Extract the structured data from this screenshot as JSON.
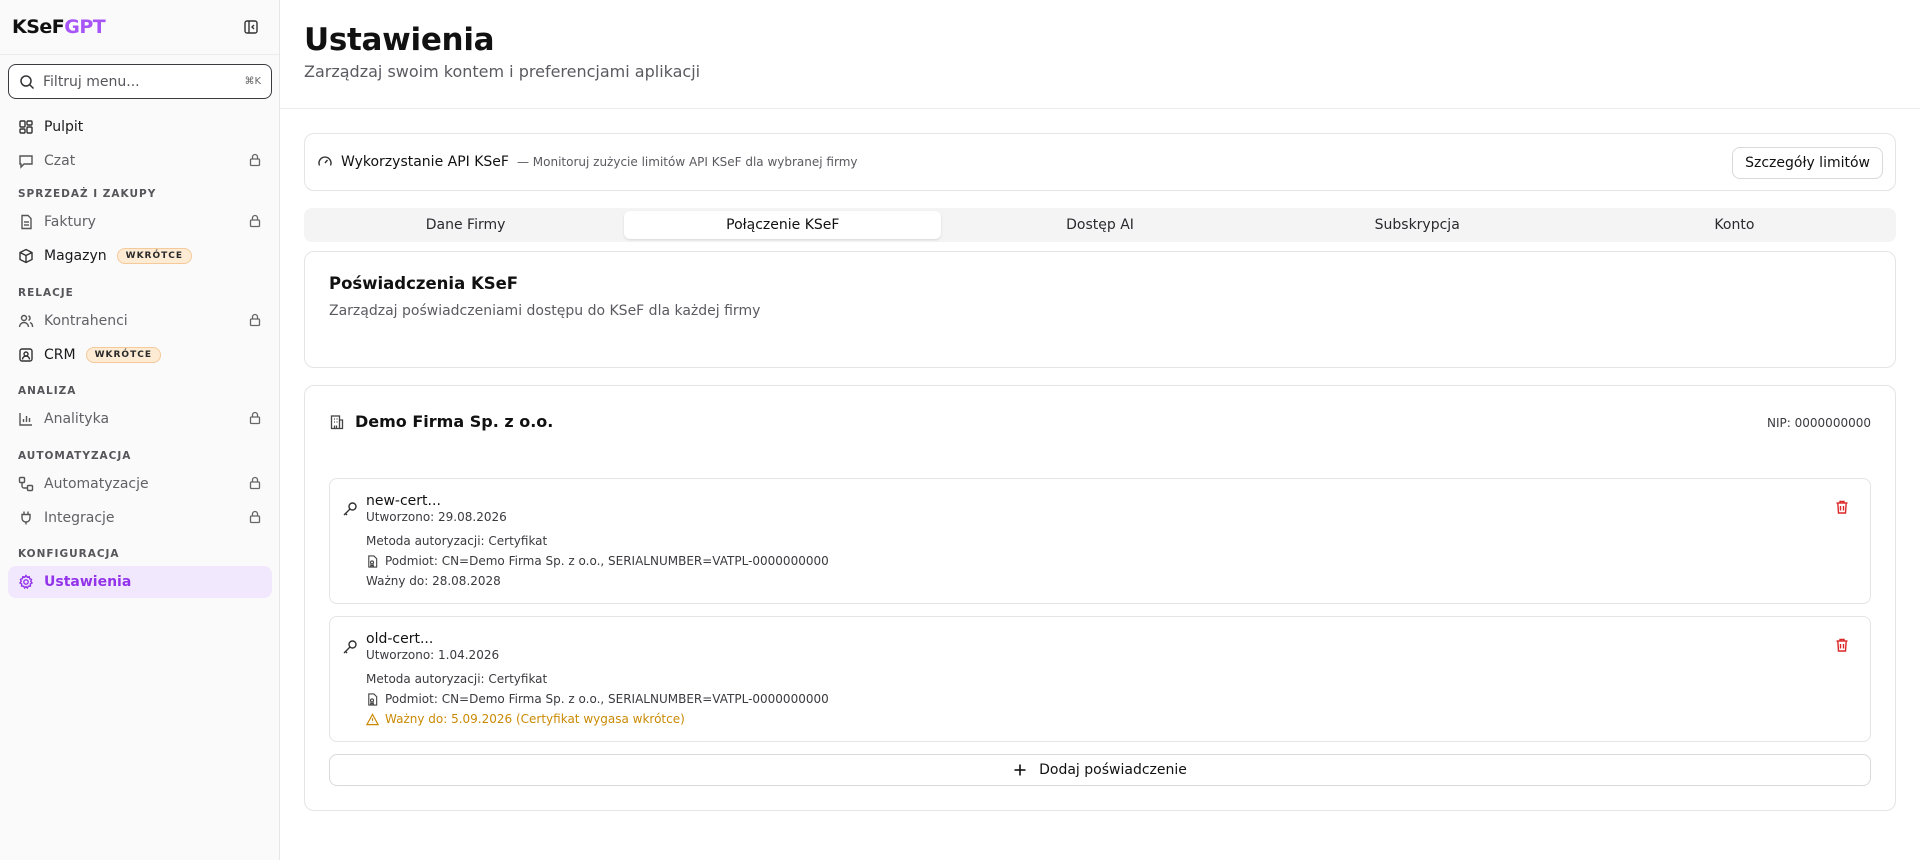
{
  "sidebar": {
    "logo_part1": "KSeF",
    "logo_part2": "GPT",
    "search_placeholder": "Filtruj menu...",
    "search_shortcut": "⌘K",
    "items": {
      "pulpit": "Pulpit",
      "czat": "Czat",
      "faktury": "Faktury",
      "magazyn": "Magazyn",
      "kontrahenci": "Kontrahenci",
      "crm": "CRM",
      "analityka": "Analityka",
      "automatyzacje": "Automatyzacje",
      "integracje": "Integracje",
      "ustawienia": "Ustawienia"
    },
    "badge_soon": "WKRÓTCE",
    "sections": {
      "sales": "SPRZEDAŻ I ZAKUPY",
      "relations": "RELACJE",
      "analysis": "ANALIZA",
      "automation": "AUTOMATYZACJA",
      "config": "KONFIGURACJA"
    }
  },
  "header": {
    "title": "Ustawienia",
    "subtitle": "Zarządzaj swoim kontem i preferencjami aplikacji"
  },
  "api_usage": {
    "title": "Wykorzystanie API KSeF",
    "description": "— Monitoruj zużycie limitów API KSeF dla wybranej firmy",
    "button": "Szczegóły limitów"
  },
  "tabs": [
    "Dane Firmy",
    "Połączenie KSeF",
    "Dostęp AI",
    "Subskrypcja",
    "Konto"
  ],
  "credentials": {
    "title": "Poświadczenia KSeF",
    "description": "Zarządzaj poświadczeniami dostępu do KSeF dla każdej firmy"
  },
  "firm": {
    "name": "Demo Firma Sp. z o.o.",
    "nip": "NIP: 0000000000",
    "certs": [
      {
        "name": "new-cert...",
        "created": "Utworzono: 29.08.2026",
        "auth": "Metoda autoryzacji:  Certyfikat",
        "subject": "Podmiot: CN=Demo Firma Sp. z o.o., SERIALNUMBER=VATPL-0000000000",
        "valid": "Ważny do: 28.08.2028"
      },
      {
        "name": "old-cert...",
        "created": "Utworzono: 1.04.2026",
        "auth": "Metoda autoryzacji:  Certyfikat",
        "subject": "Podmiot: CN=Demo Firma Sp. z o.o., SERIALNUMBER=VATPL-0000000000",
        "valid": "Ważny do: 5.09.2026 (Certyfikat wygasa wkrótce)"
      }
    ],
    "add_button": "Dodaj poświadczenie"
  },
  "colors": {
    "accent": "#a855f7",
    "active_bg": "#f1e8fd",
    "warning": "#ca8a04",
    "danger": "#dc2626",
    "badge_bg": "#fdebd3"
  }
}
